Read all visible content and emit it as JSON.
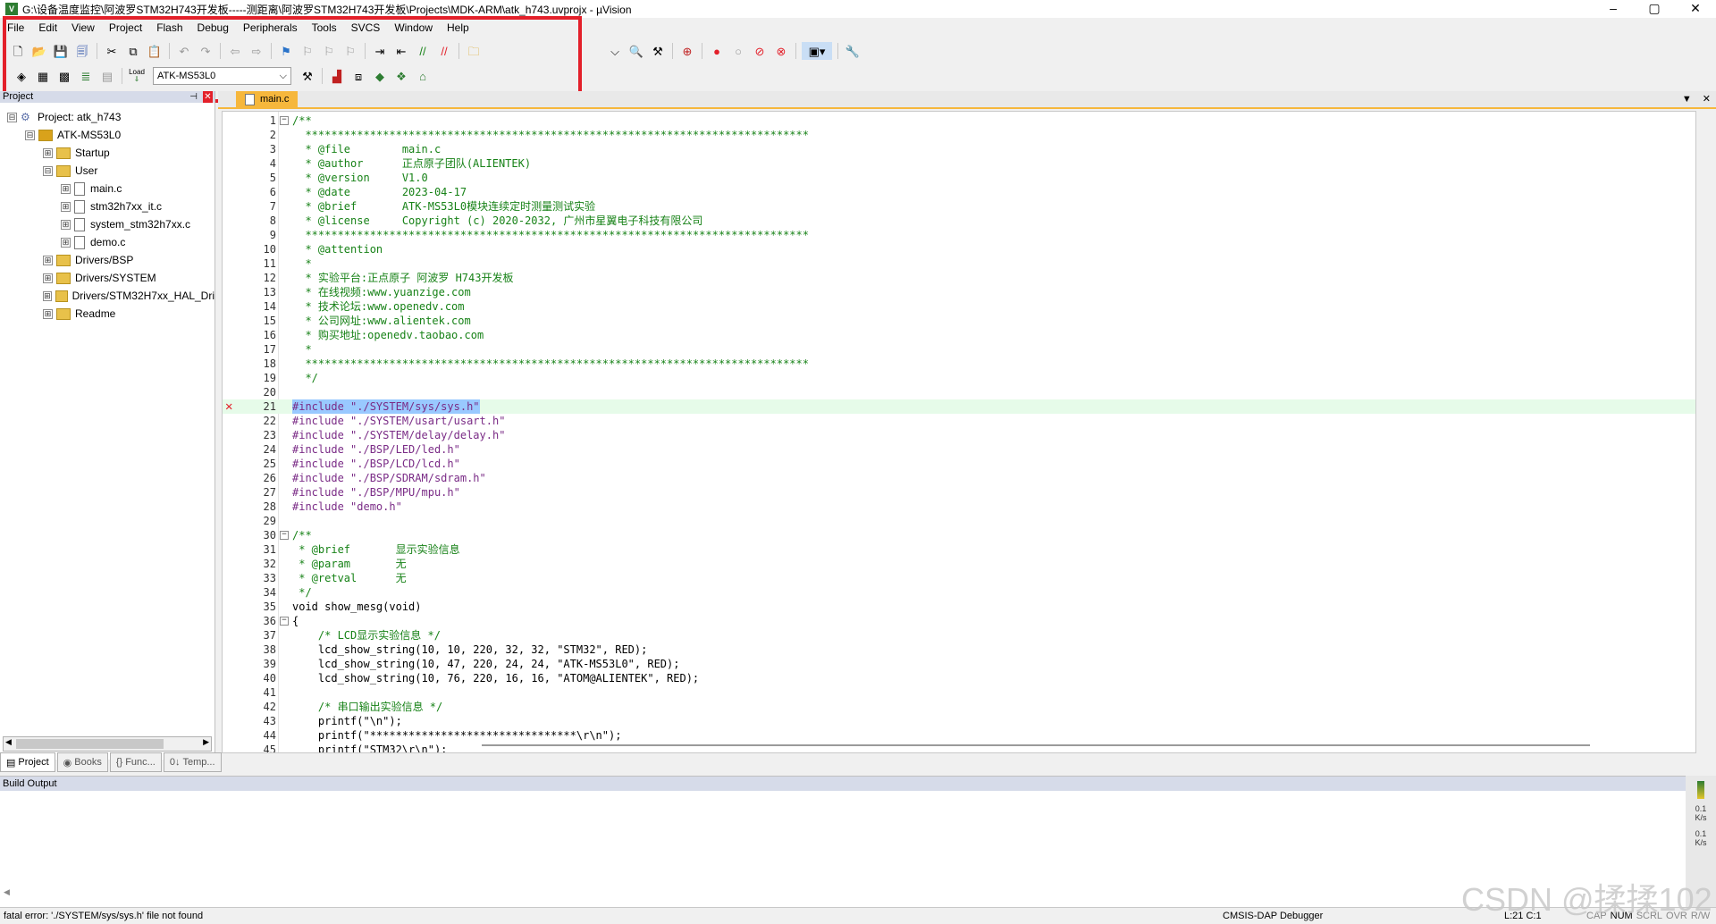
{
  "window": {
    "title": "G:\\设备温度监控\\阿波罗STM32H743开发板-----测距离\\阿波罗STM32H743开发板\\Projects\\MDK-ARM\\atk_h743.uvprojx - µVision",
    "app_icon": "V",
    "buttons": [
      "–",
      "▢",
      "✕"
    ]
  },
  "menubar": [
    "File",
    "Edit",
    "View",
    "Project",
    "Flash",
    "Debug",
    "Peripherals",
    "Tools",
    "SVCS",
    "Window",
    "Help"
  ],
  "toolbar2": {
    "load_label": "Load",
    "target": "ATK-MS53L0"
  },
  "project_panel": {
    "title": "Project",
    "tree": [
      {
        "label": "Project: atk_h743",
        "depth": 0,
        "kind": "project",
        "expander": "⊟"
      },
      {
        "label": "ATK-MS53L0",
        "depth": 1,
        "kind": "target",
        "expander": "⊟"
      },
      {
        "label": "Startup",
        "depth": 2,
        "kind": "folder",
        "expander": "⊞"
      },
      {
        "label": "User",
        "depth": 2,
        "kind": "folder",
        "expander": "⊟"
      },
      {
        "label": "main.c",
        "depth": 3,
        "kind": "file",
        "expander": "⊞"
      },
      {
        "label": "stm32h7xx_it.c",
        "depth": 3,
        "kind": "file",
        "expander": "⊞"
      },
      {
        "label": "system_stm32h7xx.c",
        "depth": 3,
        "kind": "file",
        "expander": "⊞"
      },
      {
        "label": "demo.c",
        "depth": 3,
        "kind": "file",
        "expander": "⊞"
      },
      {
        "label": "Drivers/BSP",
        "depth": 2,
        "kind": "folder",
        "expander": "⊞"
      },
      {
        "label": "Drivers/SYSTEM",
        "depth": 2,
        "kind": "folder",
        "expander": "⊞"
      },
      {
        "label": "Drivers/STM32H7xx_HAL_Dri",
        "depth": 2,
        "kind": "folder",
        "expander": "⊞"
      },
      {
        "label": "Readme",
        "depth": 2,
        "kind": "folder",
        "expander": "⊞"
      }
    ],
    "tabs": [
      {
        "label": "Project",
        "icon": "▤",
        "active": true
      },
      {
        "label": "Books",
        "icon": "◉",
        "active": false
      },
      {
        "label": "Func...",
        "icon": "{}",
        "active": false
      },
      {
        "label": "Temp...",
        "icon": "0↓",
        "active": false
      }
    ]
  },
  "editor": {
    "tab_label": "main.c",
    "current_line": 21,
    "error_line": 21,
    "lines": [
      {
        "n": "1",
        "text": "/**",
        "style": "com",
        "fold": "⊟"
      },
      {
        "n": "2",
        "text": "  ******************************************************************************",
        "style": "com"
      },
      {
        "n": "3",
        "text": "  * @file        main.c",
        "style": "com"
      },
      {
        "n": "4",
        "text": "  * @author      正点原子团队(ALIENTEK)",
        "style": "com"
      },
      {
        "n": "5",
        "text": "  * @version     V1.0",
        "style": "com"
      },
      {
        "n": "6",
        "text": "  * @date        2023-04-17",
        "style": "com"
      },
      {
        "n": "7",
        "text": "  * @brief       ATK-MS53L0模块连续定时测量测试实验",
        "style": "com"
      },
      {
        "n": "8",
        "text": "  * @license     Copyright (c) 2020-2032, 广州市星翼电子科技有限公司",
        "style": "com"
      },
      {
        "n": "9",
        "text": "  ******************************************************************************",
        "style": "com"
      },
      {
        "n": "10",
        "text": "  * @attention",
        "style": "com"
      },
      {
        "n": "11",
        "text": "  *",
        "style": "com"
      },
      {
        "n": "12",
        "text": "  * 实验平台:正点原子 阿波罗 H743开发板",
        "style": "com"
      },
      {
        "n": "13",
        "text": "  * 在线视频:www.yuanzige.com",
        "style": "com"
      },
      {
        "n": "14",
        "text": "  * 技术论坛:www.openedv.com",
        "style": "com"
      },
      {
        "n": "15",
        "text": "  * 公司网址:www.alientek.com",
        "style": "com"
      },
      {
        "n": "16",
        "text": "  * 购买地址:openedv.taobao.com",
        "style": "com"
      },
      {
        "n": "17",
        "text": "  *",
        "style": "com"
      },
      {
        "n": "18",
        "text": "  ******************************************************************************",
        "style": "com"
      },
      {
        "n": "19",
        "text": "  */",
        "style": "com"
      },
      {
        "n": "20",
        "text": "",
        "style": "plain"
      },
      {
        "n": "21",
        "text": "#include \"./SYSTEM/sys/sys.h\"",
        "style": "pp",
        "selected": true
      },
      {
        "n": "22",
        "text": "#include \"./SYSTEM/usart/usart.h\"",
        "style": "pp"
      },
      {
        "n": "23",
        "text": "#include \"./SYSTEM/delay/delay.h\"",
        "style": "pp"
      },
      {
        "n": "24",
        "text": "#include \"./BSP/LED/led.h\"",
        "style": "pp"
      },
      {
        "n": "25",
        "text": "#include \"./BSP/LCD/lcd.h\"",
        "style": "pp"
      },
      {
        "n": "26",
        "text": "#include \"./BSP/SDRAM/sdram.h\"",
        "style": "pp"
      },
      {
        "n": "27",
        "text": "#include \"./BSP/MPU/mpu.h\"",
        "style": "pp"
      },
      {
        "n": "28",
        "text": "#include \"demo.h\"",
        "style": "pp"
      },
      {
        "n": "29",
        "text": "",
        "style": "plain"
      },
      {
        "n": "30",
        "text": "/**",
        "style": "com",
        "fold": "⊟"
      },
      {
        "n": "31",
        "text": " * @brief       显示实验信息",
        "style": "com"
      },
      {
        "n": "32",
        "text": " * @param       无",
        "style": "com"
      },
      {
        "n": "33",
        "text": " * @retval      无",
        "style": "com"
      },
      {
        "n": "34",
        "text": " */",
        "style": "com"
      },
      {
        "n": "35",
        "text": "void show_mesg(void)",
        "style": "fn"
      },
      {
        "n": "36",
        "text": "{",
        "style": "plain",
        "fold": "⊟"
      },
      {
        "n": "37",
        "text": "    /* LCD显示实验信息 */",
        "style": "com"
      },
      {
        "n": "38",
        "text": "    lcd_show_string(10, 10, 220, 32, 32, \"STM32\", RED);",
        "style": "call"
      },
      {
        "n": "39",
        "text": "    lcd_show_string(10, 47, 220, 24, 24, \"ATK-MS53L0\", RED);",
        "style": "call"
      },
      {
        "n": "40",
        "text": "    lcd_show_string(10, 76, 220, 16, 16, \"ATOM@ALIENTEK\", RED);",
        "style": "call"
      },
      {
        "n": "41",
        "text": "",
        "style": "plain"
      },
      {
        "n": "42",
        "text": "    /* 串口输出实验信息 */",
        "style": "com"
      },
      {
        "n": "43",
        "text": "    printf(\"\\n\");",
        "style": "call"
      },
      {
        "n": "44",
        "text": "    printf(\"********************************\\r\\n\");",
        "style": "call"
      },
      {
        "n": "45",
        "text": "    printf(\"STM32\\r\\n\");",
        "style": "call"
      }
    ]
  },
  "build_output": {
    "title": "Build Output"
  },
  "status_bar": {
    "message": "fatal error: './SYSTEM/sys/sys.h' file not found",
    "debugger": "CMSIS-DAP Debugger",
    "position": "L:21 C:1",
    "keys": [
      "CAP",
      "NUM",
      "SCRL",
      "OVR",
      "R/W"
    ]
  },
  "side_widget": {
    "rate1": "0.1",
    "unit1": "K/s",
    "rate2": "0.1",
    "unit2": "K/s"
  },
  "watermark": "CSDN @揉揉102",
  "colors": {
    "highlight_box": "#e3202a",
    "comment": "#178217",
    "preproc": "#7a2b86",
    "keyword": "#0000ff",
    "current_line": "#e6fbe9",
    "tab_accent": "#f6b73c"
  }
}
